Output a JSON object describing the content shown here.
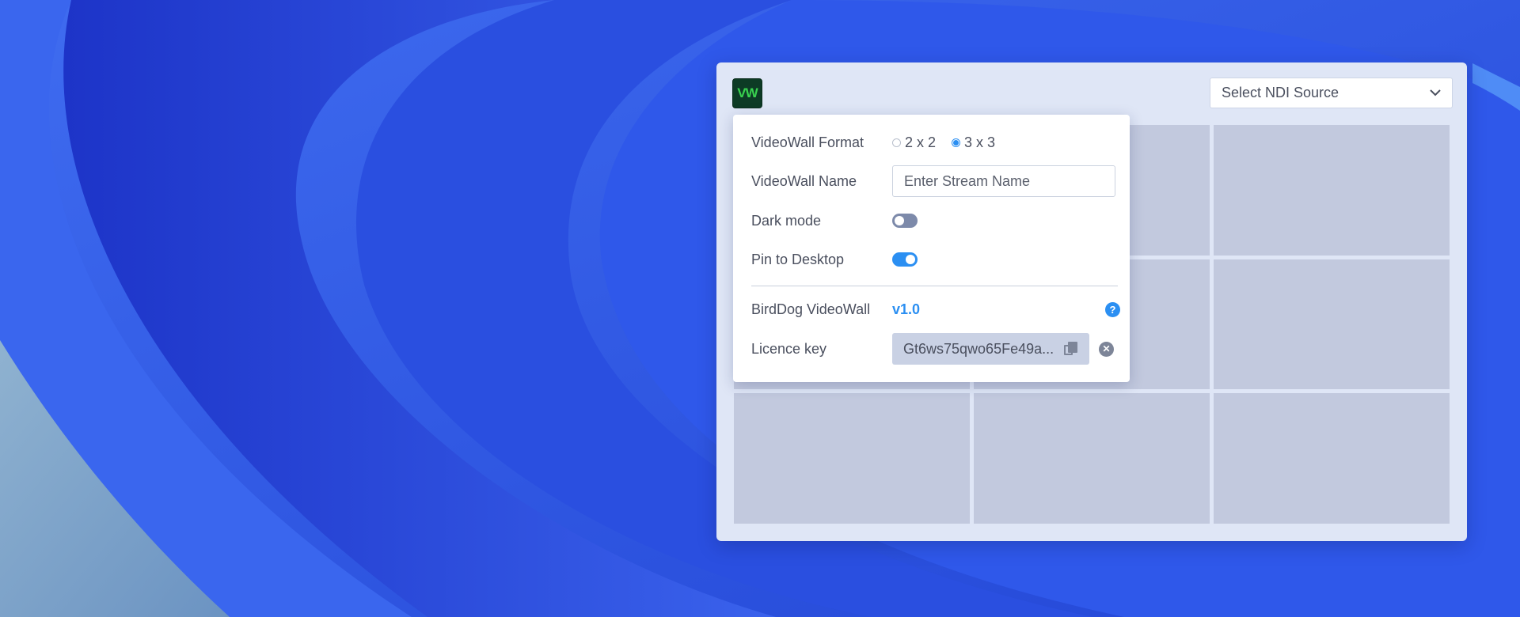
{
  "header": {
    "logo_text": "VW",
    "ndi_select": {
      "label": "Select NDI Source"
    }
  },
  "grid": {
    "cells": 9
  },
  "settings": {
    "format": {
      "label": "VideoWall Format",
      "options": [
        "2 x 2",
        "3 x 3"
      ],
      "selected": "3 x 3"
    },
    "name": {
      "label": "VideoWall Name",
      "placeholder": "Enter Stream Name",
      "value": ""
    },
    "dark_mode": {
      "label": "Dark mode",
      "enabled": false
    },
    "pin": {
      "label": "Pin to Desktop",
      "enabled": true
    },
    "product": {
      "label": "BirdDog VideoWall",
      "version": "v1.0"
    },
    "licence": {
      "label": "Licence key",
      "value": "Gt6ws75qwo65Fe49a..."
    }
  },
  "colors": {
    "accent": "#2b8ff2",
    "logo_bg": "#0d3b25",
    "logo_text": "#39d24f",
    "window_bg": "#dfe6f6",
    "cell_bg": "#c2c9de"
  }
}
